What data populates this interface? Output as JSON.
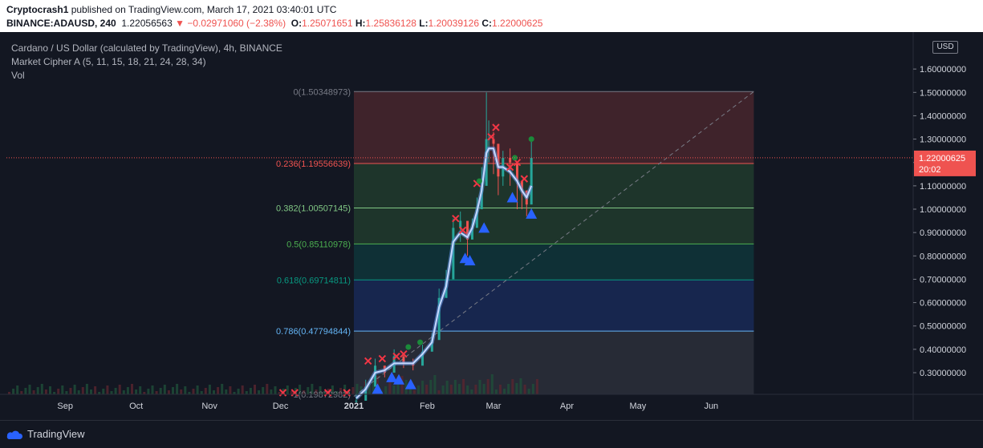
{
  "header": {
    "author": "Cryptocrash1",
    "published_text": " published on TradingView.com, March 17, 2021 03:40:01 UTC",
    "symbol": "BINANCE:ADAUSD, 240",
    "last_price": "1.22056563",
    "change": "▼ −0.02971060 (−2.38%)",
    "o_label": "O:",
    "o_value": "1.25071651",
    "h_label": "H:",
    "h_value": "1.25836128",
    "l_label": "L:",
    "l_value": "1.20039126",
    "c_label": "C:",
    "c_value": "1.22000625"
  },
  "legend": {
    "main": "Cardano / US Dollar (calculated by TradingView), 4h, BINANCE",
    "indicator": "Market Cipher A (5, 11, 15, 18, 21, 24, 28, 34)",
    "volume": "Vol"
  },
  "currency_button": "USD",
  "price_tag": {
    "value": "1.22000625",
    "countdown": "20:02",
    "color": "#ef5350"
  },
  "footer": {
    "brand": "TradingView"
  },
  "colors": {
    "background": "#131722",
    "candle_up": "#26a69a",
    "candle_down": "#ef5350",
    "ema_band": "#c5d9ff",
    "marker_buy": "#2962ff",
    "marker_sell": "#f23645",
    "dot_green": "#1b8a3a"
  },
  "chart_data": {
    "type": "candlestick",
    "title": "Cardano / US Dollar (calculated by TradingView), 4h, BINANCE",
    "y_axis": {
      "range": [
        0.18,
        1.7
      ],
      "ticks": [
        "1.60000000",
        "1.50000000",
        "1.40000000",
        "1.30000000",
        "1.20000000",
        "1.10000000",
        "1.00000000",
        "0.90000000",
        "0.80000000",
        "0.70000000",
        "0.60000000",
        "0.50000000",
        "0.40000000",
        "0.30000000"
      ],
      "tick_values": [
        1.6,
        1.5,
        1.4,
        1.3,
        1.2,
        1.1,
        1.0,
        0.9,
        0.8,
        0.7,
        0.6,
        0.5,
        0.4,
        0.3
      ]
    },
    "x_axis": {
      "labels": [
        "Sep",
        "Oct",
        "Nov",
        "Dec",
        "2021",
        "Feb",
        "Mar",
        "Apr",
        "May",
        "Jun"
      ],
      "bold_labels": [
        "2021"
      ]
    },
    "fibonacci": {
      "levels": [
        {
          "label": "0(1.50348973)",
          "ratio": 0,
          "price": 1.50348973,
          "color": "#787b86"
        },
        {
          "label": "0.236(1.19556639)",
          "ratio": 0.236,
          "price": 1.19556639,
          "color": "#ef5350"
        },
        {
          "label": "0.382(1.00507145)",
          "ratio": 0.382,
          "price": 1.00507145,
          "color": "#81c784"
        },
        {
          "label": "0.5(0.85110978)",
          "ratio": 0.5,
          "price": 0.85110978,
          "color": "#4caf50"
        },
        {
          "label": "0.618(0.69714811)",
          "ratio": 0.618,
          "price": 0.69714811,
          "color": "#089981"
        },
        {
          "label": "0.786(0.47794844)",
          "ratio": 0.786,
          "price": 0.47794844,
          "color": "#64b5f6"
        },
        {
          "label": "1(0.19872982)",
          "ratio": 1,
          "price": 0.19872982,
          "color": "#787b86"
        }
      ],
      "start_date": "2021-01-01",
      "end_date": "2021-06-19"
    },
    "price_series": {
      "dates": [
        "2021-01-02",
        "2021-01-06",
        "2021-01-10",
        "2021-01-14",
        "2021-01-18",
        "2021-01-22",
        "2021-01-26",
        "2021-01-30",
        "2021-02-03",
        "2021-02-06",
        "2021-02-09",
        "2021-02-12",
        "2021-02-15",
        "2021-02-18",
        "2021-02-20",
        "2021-02-22",
        "2021-02-24",
        "2021-02-26",
        "2021-02-27",
        "2021-03-01",
        "2021-03-03",
        "2021-03-05",
        "2021-03-08",
        "2021-03-11",
        "2021-03-13",
        "2021-03-15",
        "2021-03-17"
      ],
      "close": [
        0.18,
        0.24,
        0.33,
        0.3,
        0.37,
        0.34,
        0.33,
        0.39,
        0.44,
        0.62,
        0.7,
        0.92,
        0.95,
        0.87,
        0.92,
        1.0,
        1.1,
        1.3,
        1.3,
        1.28,
        1.14,
        1.22,
        1.2,
        1.12,
        1.08,
        1.02,
        1.22
      ],
      "high": [
        0.21,
        0.27,
        0.36,
        0.33,
        0.4,
        0.38,
        0.36,
        0.42,
        0.47,
        0.66,
        0.74,
        0.96,
        0.99,
        0.9,
        0.96,
        1.05,
        1.18,
        1.5,
        1.38,
        1.33,
        1.2,
        1.25,
        1.26,
        1.17,
        1.12,
        1.08,
        1.3
      ],
      "low": [
        0.17,
        0.22,
        0.3,
        0.28,
        0.34,
        0.32,
        0.31,
        0.36,
        0.42,
        0.58,
        0.66,
        0.88,
        0.86,
        0.8,
        0.88,
        0.96,
        1.04,
        1.22,
        1.2,
        1.15,
        1.06,
        1.1,
        1.1,
        1.0,
        1.0,
        0.97,
        1.18
      ]
    },
    "ema_band": [
      0.19,
      0.23,
      0.3,
      0.31,
      0.34,
      0.34,
      0.34,
      0.38,
      0.43,
      0.58,
      0.67,
      0.86,
      0.9,
      0.88,
      0.92,
      0.99,
      1.08,
      1.24,
      1.26,
      1.26,
      1.18,
      1.18,
      1.16,
      1.12,
      1.08,
      1.05,
      1.1
    ],
    "buy_markers": [
      {
        "date": "2021-01-11",
        "price": 0.23
      },
      {
        "date": "2021-01-17",
        "price": 0.28
      },
      {
        "date": "2021-01-20",
        "price": 0.27
      },
      {
        "date": "2021-01-25",
        "price": 0.25
      },
      {
        "date": "2021-02-17",
        "price": 0.79
      },
      {
        "date": "2021-02-19",
        "price": 0.78
      },
      {
        "date": "2021-02-25",
        "price": 0.92
      },
      {
        "date": "2021-03-09",
        "price": 1.05
      },
      {
        "date": "2021-03-17",
        "price": 0.98
      }
    ],
    "sell_markers": [
      {
        "date": "2020-12-02",
        "price": 0.185
      },
      {
        "date": "2020-12-07",
        "price": 0.18
      },
      {
        "date": "2020-12-21",
        "price": 0.18
      },
      {
        "date": "2020-12-29",
        "price": 0.2
      },
      {
        "date": "2021-01-07",
        "price": 0.35
      },
      {
        "date": "2021-01-13",
        "price": 0.36
      },
      {
        "date": "2021-01-19",
        "price": 0.37
      },
      {
        "date": "2021-01-22",
        "price": 0.38
      },
      {
        "date": "2021-02-13",
        "price": 0.96
      },
      {
        "date": "2021-02-16",
        "price": 0.91
      },
      {
        "date": "2021-02-22",
        "price": 1.11
      },
      {
        "date": "2021-02-28",
        "price": 1.31
      },
      {
        "date": "2021-03-02",
        "price": 1.35
      },
      {
        "date": "2021-03-08",
        "price": 1.18
      },
      {
        "date": "2021-03-11",
        "price": 1.2
      },
      {
        "date": "2021-03-14",
        "price": 1.13
      }
    ],
    "dot_markers": [
      {
        "date": "2021-01-24",
        "price": 0.41
      },
      {
        "date": "2021-01-29",
        "price": 0.43
      },
      {
        "date": "2021-02-23",
        "price": 1.12
      },
      {
        "date": "2021-03-10",
        "price": 1.22
      },
      {
        "date": "2021-03-17",
        "price": 1.3
      }
    ],
    "last_price": 1.22000625
  }
}
